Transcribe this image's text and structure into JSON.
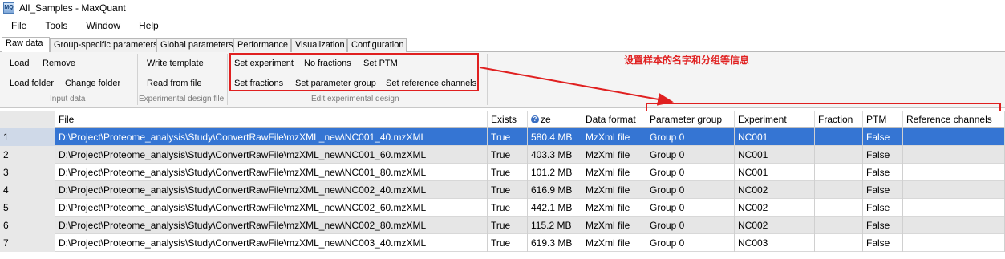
{
  "window": {
    "title": "All_Samples - MaxQuant",
    "icon": "maxquant-app-icon"
  },
  "menu": [
    "File",
    "Tools",
    "Window",
    "Help"
  ],
  "tabs": [
    {
      "label": "Raw data",
      "active": true
    },
    {
      "label": "Group-specific parameters"
    },
    {
      "label": "Global parameters"
    },
    {
      "label": "Performance"
    },
    {
      "label": "Visualization"
    },
    {
      "label": "Configuration"
    }
  ],
  "ribbon": {
    "input_data": {
      "load": "Load",
      "remove": "Remove",
      "load_folder": "Load folder",
      "change_folder": "Change folder",
      "group_label": "Input data"
    },
    "experimental_design_file": {
      "write_template": "Write template",
      "read_from_file": "Read from file",
      "group_label": "Experimental design file"
    },
    "edit_experimental_design": {
      "set_experiment": "Set experiment",
      "no_fractions": "No fractions",
      "set_ptm": "Set PTM",
      "set_fractions": "Set fractions",
      "set_parameter_group": "Set parameter group",
      "set_reference_channels": "Set reference channels",
      "group_label": "Edit experimental design"
    }
  },
  "annotation": {
    "text": "设置样本的名字和分组等信息",
    "color": "#e02020"
  },
  "table": {
    "columns": {
      "file": "File",
      "exists": "Exists",
      "size": "ze",
      "data_format": "Data format",
      "parameter_group": "Parameter group",
      "experiment": "Experiment",
      "fraction": "Fraction",
      "ptm": "PTM",
      "reference_channels": "Reference channels"
    },
    "rows": [
      {
        "n": "1",
        "file": "D:\\Project\\Proteome_analysis\\Study\\ConvertRawFile\\mzXML_new\\NC001_40.mzXML",
        "exists": "True",
        "size": "580.4 MB",
        "format": "MzXml file",
        "group": "Group 0",
        "experiment": "NC001",
        "fraction": "",
        "ptm": "False",
        "ref": ""
      },
      {
        "n": "2",
        "file": "D:\\Project\\Proteome_analysis\\Study\\ConvertRawFile\\mzXML_new\\NC001_60.mzXML",
        "exists": "True",
        "size": "403.3 MB",
        "format": "MzXml file",
        "group": "Group 0",
        "experiment": "NC001",
        "fraction": "",
        "ptm": "False",
        "ref": ""
      },
      {
        "n": "3",
        "file": "D:\\Project\\Proteome_analysis\\Study\\ConvertRawFile\\mzXML_new\\NC001_80.mzXML",
        "exists": "True",
        "size": "101.2 MB",
        "format": "MzXml file",
        "group": "Group 0",
        "experiment": "NC001",
        "fraction": "",
        "ptm": "False",
        "ref": ""
      },
      {
        "n": "4",
        "file": "D:\\Project\\Proteome_analysis\\Study\\ConvertRawFile\\mzXML_new\\NC002_40.mzXML",
        "exists": "True",
        "size": "616.9 MB",
        "format": "MzXml file",
        "group": "Group 0",
        "experiment": "NC002",
        "fraction": "",
        "ptm": "False",
        "ref": ""
      },
      {
        "n": "5",
        "file": "D:\\Project\\Proteome_analysis\\Study\\ConvertRawFile\\mzXML_new\\NC002_60.mzXML",
        "exists": "True",
        "size": "442.1 MB",
        "format": "MzXml file",
        "group": "Group 0",
        "experiment": "NC002",
        "fraction": "",
        "ptm": "False",
        "ref": ""
      },
      {
        "n": "6",
        "file": "D:\\Project\\Proteome_analysis\\Study\\ConvertRawFile\\mzXML_new\\NC002_80.mzXML",
        "exists": "True",
        "size": "115.2 MB",
        "format": "MzXml file",
        "group": "Group 0",
        "experiment": "NC002",
        "fraction": "",
        "ptm": "False",
        "ref": ""
      },
      {
        "n": "7",
        "file": "D:\\Project\\Proteome_analysis\\Study\\ConvertRawFile\\mzXML_new\\NC003_40.mzXML",
        "exists": "True",
        "size": "619.3 MB",
        "format": "MzXml file",
        "group": "Group 0",
        "experiment": "NC003",
        "fraction": "",
        "ptm": "False",
        "ref": ""
      }
    ],
    "selected_row": 0
  }
}
